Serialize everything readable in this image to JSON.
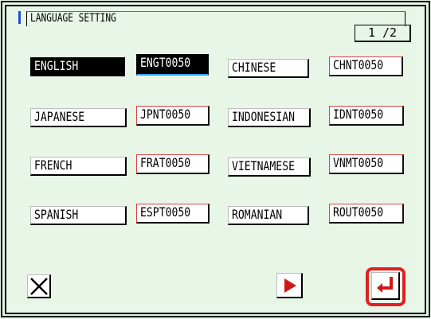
{
  "title": "LANGUAGE SETTING",
  "page_indicator": "1 /2",
  "languages": [
    {
      "name": "ENGLISH",
      "code": "ENGT0050",
      "selected": true
    },
    {
      "name": "CHINESE",
      "code": "CHNT0050",
      "selected": false
    },
    {
      "name": "JAPANESE",
      "code": "JPNT0050",
      "selected": false
    },
    {
      "name": "INDONESIAN",
      "code": "IDNT0050",
      "selected": false
    },
    {
      "name": "FRENCH",
      "code": "FRAT0050",
      "selected": false
    },
    {
      "name": "VIETNAMESE",
      "code": "VNMT0050",
      "selected": false
    },
    {
      "name": "SPANISH",
      "code": "ESPT0050",
      "selected": false
    },
    {
      "name": "ROMANIAN",
      "code": "ROUT0050",
      "selected": false
    }
  ],
  "buttons": {
    "cancel_icon": "close-icon",
    "next_icon": "play-right-icon",
    "enter_icon": "enter-icon"
  },
  "colors": {
    "background": "#e8f6e8",
    "highlight": "#e02020",
    "accent_blue": "#1f4bd8"
  }
}
